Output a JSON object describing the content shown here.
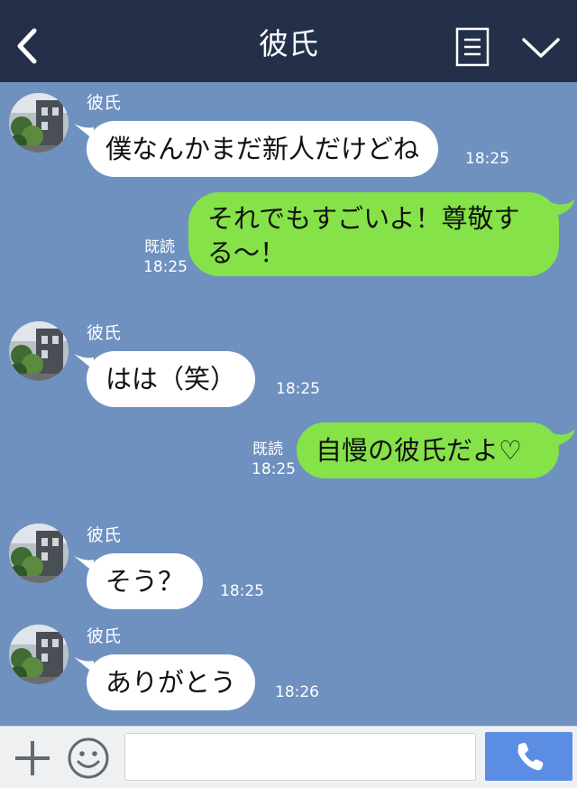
{
  "header": {
    "title": "彼氏",
    "back_icon": "chevron-left-icon",
    "menu_icon": "menu-list-icon",
    "collapse_icon": "chevron-down-icon"
  },
  "messages": [
    {
      "side": "in",
      "sender": "彼氏",
      "lines": [
        "僕なんかまだ新人だけどね"
      ],
      "time": "18:25"
    },
    {
      "side": "out",
      "read": "既読",
      "lines": [
        "それでもすごいよ！尊敬す",
        "る〜！"
      ],
      "time": "18:25"
    },
    {
      "side": "in",
      "sender": "彼氏",
      "lines": [
        "はは（笑）"
      ],
      "time": "18:25"
    },
    {
      "side": "out",
      "read": "既読",
      "lines": [
        "自慢の彼氏だよ♡"
      ],
      "time": "18:25"
    },
    {
      "side": "in",
      "sender": "彼氏",
      "lines": [
        "そう？"
      ],
      "time": "18:25"
    },
    {
      "side": "in",
      "sender": "彼氏",
      "lines": [
        "ありがとう"
      ],
      "time": "18:26"
    }
  ],
  "input": {
    "value": "",
    "placeholder": ""
  },
  "footer": {
    "plus_icon": "plus-icon",
    "emoji_icon": "smiley-icon",
    "call_icon": "phone-icon"
  },
  "colors": {
    "header_bg": "#243049",
    "chat_bg": "#6f91bf",
    "incoming_bubble": "#ffffff",
    "outgoing_bubble": "#85e249",
    "call_button": "#5b8ee3"
  }
}
